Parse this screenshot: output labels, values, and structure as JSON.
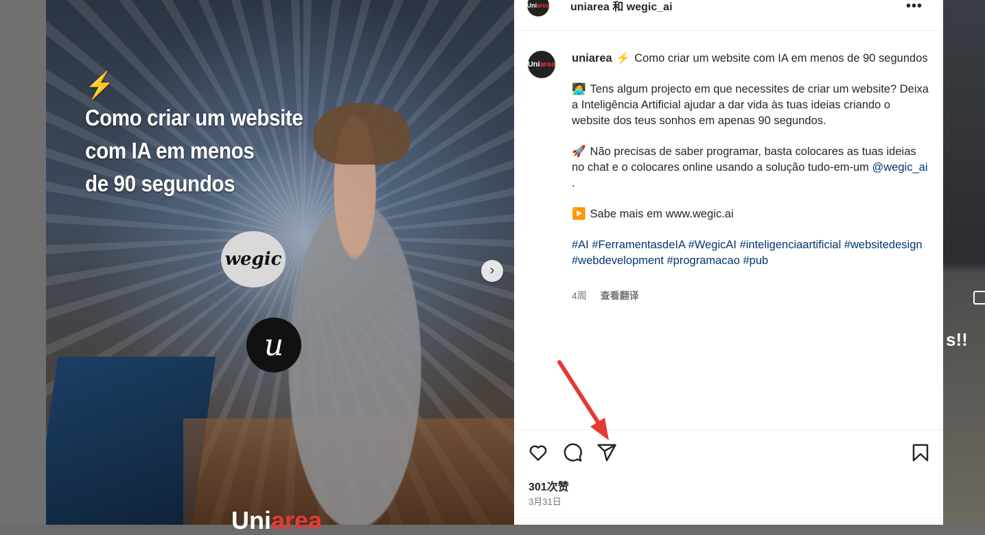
{
  "media": {
    "headline_lines": [
      "Como criar um website",
      "com IA em menos",
      "de 90 segundos"
    ],
    "bolt_glyph": "⚡",
    "wegic_logo": "wegic",
    "u_logo": "u",
    "next_glyph": "›",
    "brand_uni": "Uni",
    "brand_area": "area"
  },
  "header": {
    "avatar": {
      "uni": "Uni",
      "area": "area"
    },
    "names": "uniarea 和 wegic_ai",
    "more": "•••"
  },
  "post": {
    "avatar": {
      "uni": "Uni",
      "area": "area"
    },
    "username": "uniarea",
    "title": "Como criar um website com IA em menos de 90 segundos",
    "para1_emoji": "🧑‍💻",
    "para1": "Tens algum projecto em que necessites de criar um website? Deixa a Inteligência Artificial ajudar a dar vida às tuas ideias criando o website dos teus sonhos em apenas 90 segundos.",
    "para2_emoji": "🚀",
    "para2": "Não precisas de saber programar, basta colocares as tuas ideias no chat e o colocares online usando a solução tudo-em-um",
    "mention": "@wegic_ai",
    "para2_end": " .",
    "para3_emoji": "▶️",
    "para3": "Sabe mais em www.wegic.ai",
    "hashtags": "#AI #FerramentasdeIA #WegicAI #inteligenciaartificial #websitedesign #webdevelopment #programacao #pub",
    "age": "4周",
    "translate": "查看翻译"
  },
  "stats": {
    "likes": "301次赞",
    "date": "3月31日"
  },
  "right_peek": {
    "text": "s!!"
  },
  "colors": {
    "link": "#00376b",
    "text": "#262626",
    "muted": "#737373",
    "annotation_arrow": "#e53935"
  },
  "icons": [
    "heart-icon",
    "comment-icon",
    "share-icon",
    "bookmark-icon",
    "more-icon",
    "chevron-right-icon"
  ]
}
